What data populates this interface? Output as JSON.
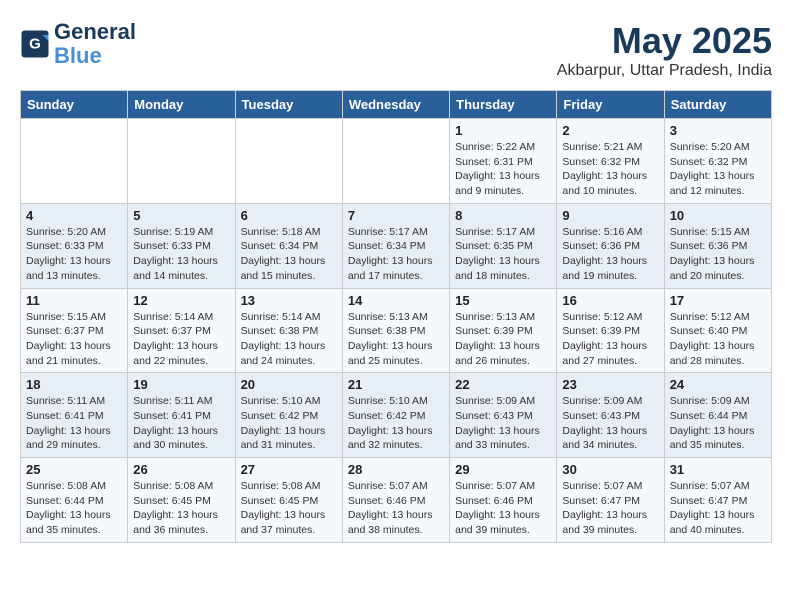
{
  "header": {
    "logo_line1": "General",
    "logo_line2": "Blue",
    "month": "May 2025",
    "location": "Akbarpur, Uttar Pradesh, India"
  },
  "weekdays": [
    "Sunday",
    "Monday",
    "Tuesday",
    "Wednesday",
    "Thursday",
    "Friday",
    "Saturday"
  ],
  "weeks": [
    [
      {
        "day": "",
        "info": ""
      },
      {
        "day": "",
        "info": ""
      },
      {
        "day": "",
        "info": ""
      },
      {
        "day": "",
        "info": ""
      },
      {
        "day": "1",
        "info": "Sunrise: 5:22 AM\nSunset: 6:31 PM\nDaylight: 13 hours and 9 minutes."
      },
      {
        "day": "2",
        "info": "Sunrise: 5:21 AM\nSunset: 6:32 PM\nDaylight: 13 hours and 10 minutes."
      },
      {
        "day": "3",
        "info": "Sunrise: 5:20 AM\nSunset: 6:32 PM\nDaylight: 13 hours and 12 minutes."
      }
    ],
    [
      {
        "day": "4",
        "info": "Sunrise: 5:20 AM\nSunset: 6:33 PM\nDaylight: 13 hours and 13 minutes."
      },
      {
        "day": "5",
        "info": "Sunrise: 5:19 AM\nSunset: 6:33 PM\nDaylight: 13 hours and 14 minutes."
      },
      {
        "day": "6",
        "info": "Sunrise: 5:18 AM\nSunset: 6:34 PM\nDaylight: 13 hours and 15 minutes."
      },
      {
        "day": "7",
        "info": "Sunrise: 5:17 AM\nSunset: 6:34 PM\nDaylight: 13 hours and 17 minutes."
      },
      {
        "day": "8",
        "info": "Sunrise: 5:17 AM\nSunset: 6:35 PM\nDaylight: 13 hours and 18 minutes."
      },
      {
        "day": "9",
        "info": "Sunrise: 5:16 AM\nSunset: 6:36 PM\nDaylight: 13 hours and 19 minutes."
      },
      {
        "day": "10",
        "info": "Sunrise: 5:15 AM\nSunset: 6:36 PM\nDaylight: 13 hours and 20 minutes."
      }
    ],
    [
      {
        "day": "11",
        "info": "Sunrise: 5:15 AM\nSunset: 6:37 PM\nDaylight: 13 hours and 21 minutes."
      },
      {
        "day": "12",
        "info": "Sunrise: 5:14 AM\nSunset: 6:37 PM\nDaylight: 13 hours and 22 minutes."
      },
      {
        "day": "13",
        "info": "Sunrise: 5:14 AM\nSunset: 6:38 PM\nDaylight: 13 hours and 24 minutes."
      },
      {
        "day": "14",
        "info": "Sunrise: 5:13 AM\nSunset: 6:38 PM\nDaylight: 13 hours and 25 minutes."
      },
      {
        "day": "15",
        "info": "Sunrise: 5:13 AM\nSunset: 6:39 PM\nDaylight: 13 hours and 26 minutes."
      },
      {
        "day": "16",
        "info": "Sunrise: 5:12 AM\nSunset: 6:39 PM\nDaylight: 13 hours and 27 minutes."
      },
      {
        "day": "17",
        "info": "Sunrise: 5:12 AM\nSunset: 6:40 PM\nDaylight: 13 hours and 28 minutes."
      }
    ],
    [
      {
        "day": "18",
        "info": "Sunrise: 5:11 AM\nSunset: 6:41 PM\nDaylight: 13 hours and 29 minutes."
      },
      {
        "day": "19",
        "info": "Sunrise: 5:11 AM\nSunset: 6:41 PM\nDaylight: 13 hours and 30 minutes."
      },
      {
        "day": "20",
        "info": "Sunrise: 5:10 AM\nSunset: 6:42 PM\nDaylight: 13 hours and 31 minutes."
      },
      {
        "day": "21",
        "info": "Sunrise: 5:10 AM\nSunset: 6:42 PM\nDaylight: 13 hours and 32 minutes."
      },
      {
        "day": "22",
        "info": "Sunrise: 5:09 AM\nSunset: 6:43 PM\nDaylight: 13 hours and 33 minutes."
      },
      {
        "day": "23",
        "info": "Sunrise: 5:09 AM\nSunset: 6:43 PM\nDaylight: 13 hours and 34 minutes."
      },
      {
        "day": "24",
        "info": "Sunrise: 5:09 AM\nSunset: 6:44 PM\nDaylight: 13 hours and 35 minutes."
      }
    ],
    [
      {
        "day": "25",
        "info": "Sunrise: 5:08 AM\nSunset: 6:44 PM\nDaylight: 13 hours and 35 minutes."
      },
      {
        "day": "26",
        "info": "Sunrise: 5:08 AM\nSunset: 6:45 PM\nDaylight: 13 hours and 36 minutes."
      },
      {
        "day": "27",
        "info": "Sunrise: 5:08 AM\nSunset: 6:45 PM\nDaylight: 13 hours and 37 minutes."
      },
      {
        "day": "28",
        "info": "Sunrise: 5:07 AM\nSunset: 6:46 PM\nDaylight: 13 hours and 38 minutes."
      },
      {
        "day": "29",
        "info": "Sunrise: 5:07 AM\nSunset: 6:46 PM\nDaylight: 13 hours and 39 minutes."
      },
      {
        "day": "30",
        "info": "Sunrise: 5:07 AM\nSunset: 6:47 PM\nDaylight: 13 hours and 39 minutes."
      },
      {
        "day": "31",
        "info": "Sunrise: 5:07 AM\nSunset: 6:47 PM\nDaylight: 13 hours and 40 minutes."
      }
    ]
  ]
}
